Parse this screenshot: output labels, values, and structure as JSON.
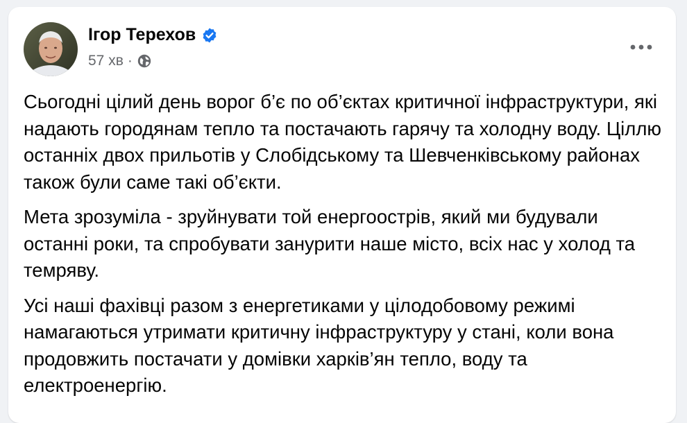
{
  "post": {
    "author": "Ігор Терехов",
    "time": "57 хв",
    "separator": "·",
    "paragraphs": [
      "Сьогодні цілий день ворог б’є по об’єктах критичної інфраструктури, які надають городянам тепло та постачають гарячу та холодну воду. Ціллю останніх двох прильотів у Слобідському та Шевченківському районах також були саме такі об’єкти.",
      "Мета зрозуміла - зруйнувати той енергоострів, який ми будували останні роки, та спробувати занурити наше місто, всіх нас у холод та темряву.",
      "Усі наші фахівці разом з енергетиками у цілодобовому режимі намагаються утримати критичну інфраструктуру у стані, коли вона продовжить постачати у домівки харків’ян тепло, воду та електроенергію."
    ]
  },
  "icons": {
    "verified": "verified-badge-icon",
    "audience": "globe-icon",
    "more": "more-horizontal-icon"
  },
  "colors": {
    "verified_blue": "#1877f2",
    "text_primary": "#050505",
    "text_secondary": "#65676b"
  }
}
